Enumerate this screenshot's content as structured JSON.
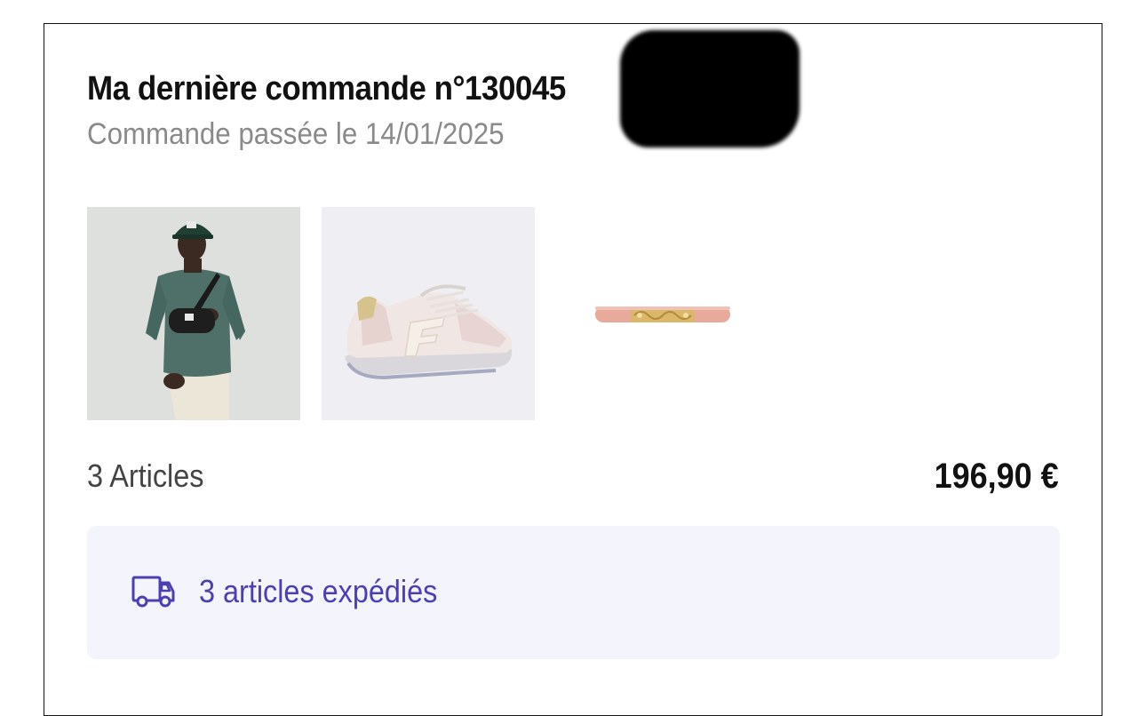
{
  "order": {
    "title": "Ma dernière commande n°130045",
    "date_line": "Commande passée le 14/01/2025",
    "articles_count": "3 Articles",
    "total": "196,90 €",
    "shipping_status": "3 articles expédiés",
    "shipping_icon": "truck-icon",
    "accent_color": "#4b3fb3",
    "shipping_bg": "#f4f4fd"
  },
  "products": [
    {
      "kind": "sweatshirt-cap-bag-photo"
    },
    {
      "kind": "sneaker-photo"
    },
    {
      "kind": "belt-photo"
    }
  ]
}
